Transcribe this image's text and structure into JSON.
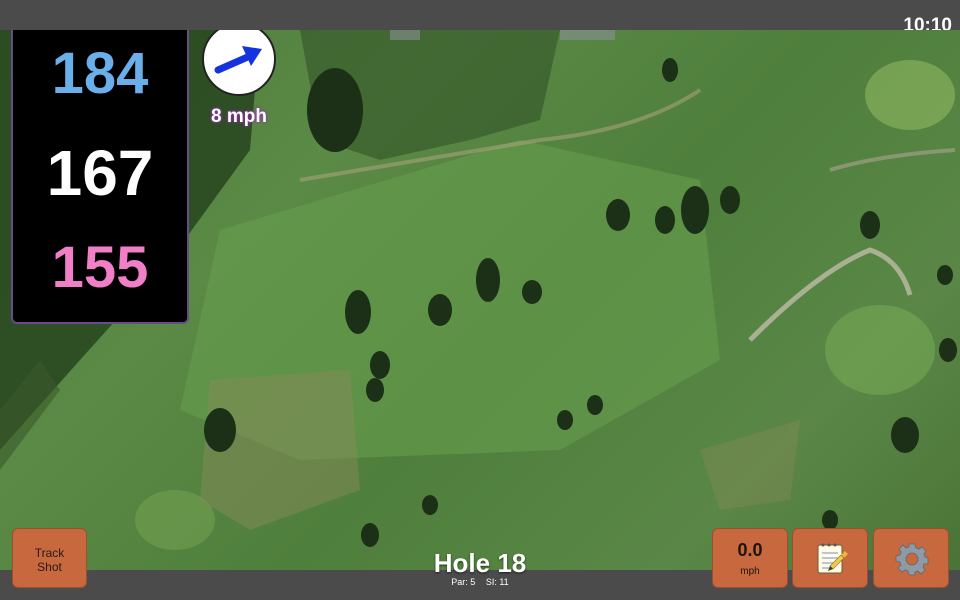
{
  "status_bar": {
    "time": "10:10"
  },
  "distances": {
    "back": "184",
    "center": "167",
    "front": "155"
  },
  "wind": {
    "speed_label": "8 mph",
    "direction_icon": "wind-arrow-icon"
  },
  "buttons": {
    "track_shot": {
      "line1": "Track",
      "line2": "Shot"
    },
    "speed": {
      "value": "0.0",
      "unit": "mph"
    },
    "notes_icon": "notepad-icon",
    "settings_icon": "gear-icon"
  },
  "hole": {
    "title": "Hole 18",
    "par": "Par: 5",
    "si": "SI: 11"
  },
  "colors": {
    "back": "#6aaeea",
    "center": "#ffffff",
    "front": "#f07fc7",
    "button": "#c7683e"
  }
}
